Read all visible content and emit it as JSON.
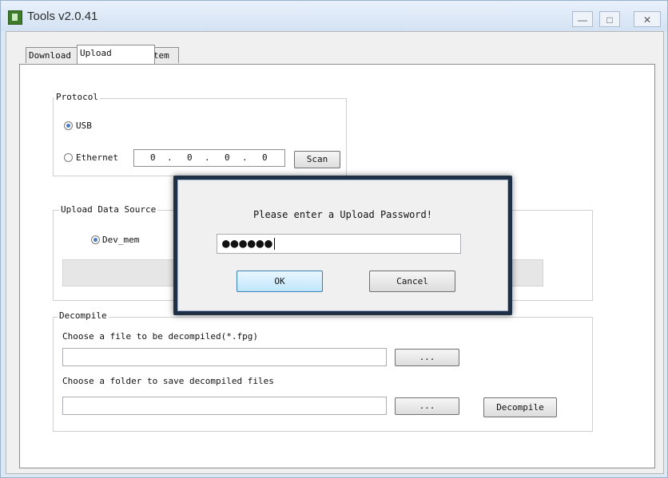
{
  "window": {
    "title": "Tools v2.0.41",
    "min_glyph": "—",
    "max_glyph": "□",
    "close_glyph": "✕"
  },
  "tabs": [
    {
      "label": "Download",
      "active": false
    },
    {
      "label": "Upload",
      "active": true
    },
    {
      "label": "System",
      "active": false
    }
  ],
  "protocol": {
    "legend": "Protocol",
    "options": [
      {
        "label": "USB",
        "selected": true
      },
      {
        "label": "Ethernet",
        "selected": false
      }
    ],
    "ip": [
      "0",
      "0",
      "0",
      "0"
    ],
    "ip_sep": ".",
    "scan_label": "Scan"
  },
  "upload_source": {
    "legend": "Upload Data Source",
    "option": {
      "label": "Dev_mem",
      "selected": true
    }
  },
  "decompile": {
    "legend": "Decompile",
    "choose_file_label": "Choose a file to be decompiled(*.fpg)",
    "choose_file_value": "",
    "browse1_label": "...",
    "choose_folder_label": "Choose a folder to save decompiled files",
    "choose_folder_value": "",
    "browse2_label": "...",
    "decompile_label": "Decompile"
  },
  "dialog": {
    "prompt": "Please enter a Upload Password!",
    "password_mask": "●●●●●●",
    "ok_label": "OK",
    "cancel_label": "Cancel"
  }
}
